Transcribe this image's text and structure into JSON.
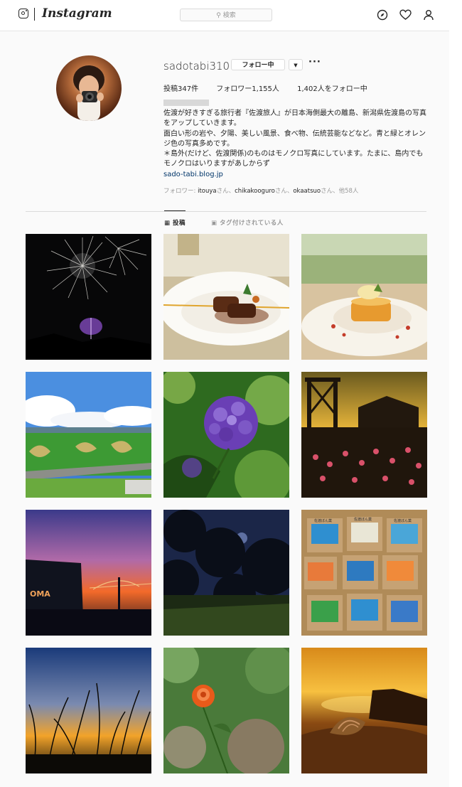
{
  "header": {
    "wordmark": "Instagram",
    "search_placeholder": "検索",
    "icons": [
      "instagram-glyph-icon",
      "compass-icon",
      "heart-icon",
      "person-icon"
    ]
  },
  "profile": {
    "username": "sadotabi310",
    "follow_button": "フォロー中",
    "dropdown_glyph": "▼",
    "more_glyph": "···",
    "stats": {
      "posts": "投稿347件",
      "followers": "フォロワー1,155人",
      "following": "1,402人をフォロー中"
    },
    "bio_lines": [
      "佐渡が好きすぎる旅行者『佐渡旅人』が日本海側最大の離島、新潟県佐渡島の写真をアップしていきます。",
      "面白い形の岩や、夕陽、美しい風景、食べ物、伝統芸能などなど。青と緑とオレンジ色の写真多めです。",
      "＊島外(だけど、佐渡関係)のものはモノクロ写真にしています。たまに、島内でもモノクロはいりますがあしからず"
    ],
    "website": "sado-tabi.blog.jp",
    "followed_by": {
      "prefix": "フォロワー: ",
      "user1": "itouya",
      "suffix1": "さん、",
      "user2": "chikakooguro",
      "suffix2": "さん、",
      "user3": "okaatsuo",
      "suffix3": "さん、他58人"
    }
  },
  "tabs": {
    "posts": "投稿",
    "tagged": "タグ付けされている人"
  },
  "accent_colors": {
    "link": "#003569",
    "muted": "#999999",
    "border": "#dbdbdb"
  },
  "posts": [
    {
      "subject": "fireworks"
    },
    {
      "subject": "meat dish"
    },
    {
      "subject": "dessert"
    },
    {
      "subject": "rice field art"
    },
    {
      "subject": "hydrangea"
    },
    {
      "subject": "mine ruins sunset"
    },
    {
      "subject": "oma sunset"
    },
    {
      "subject": "night trees"
    },
    {
      "subject": "souvenir packages",
      "package_label": "佐渡ぼん菓"
    },
    {
      "subject": "grass silhouette sunset"
    },
    {
      "subject": "orange rose"
    },
    {
      "subject": "seashell sunset"
    }
  ]
}
